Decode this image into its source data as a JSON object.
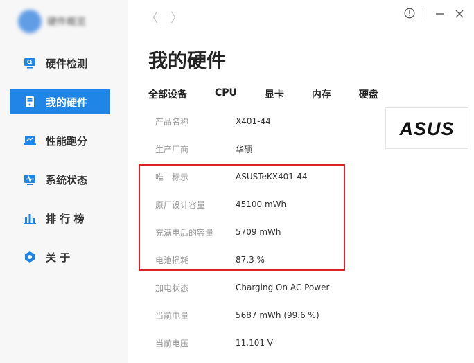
{
  "sidebar": {
    "app_name": "硬件概览",
    "items": [
      {
        "label": "硬件检测",
        "icon": "monitor-search-icon",
        "active": false
      },
      {
        "label": "我的硬件",
        "icon": "pc-tower-icon",
        "active": true
      },
      {
        "label": "性能跑分",
        "icon": "laptop-score-icon",
        "active": false
      },
      {
        "label": "系统状态",
        "icon": "pulse-icon",
        "active": false
      },
      {
        "label": "排 行 榜",
        "icon": "bar-chart-icon",
        "active": false
      },
      {
        "label": "关 于",
        "icon": "info-hexagon-icon",
        "active": false
      }
    ]
  },
  "header": {
    "back": "〈",
    "forward": "〉"
  },
  "main": {
    "title": "我的硬件",
    "tabs": [
      "全部设备",
      "CPU",
      "显卡",
      "内存",
      "硬盘"
    ],
    "brand": "ASUS",
    "rows": [
      {
        "label": "产品名称",
        "value": "X401-44"
      },
      {
        "label": "生产厂商",
        "value": "华硕"
      },
      {
        "label": "唯一标示",
        "value": "ASUSTeKX401-44"
      },
      {
        "label": "原厂设计容量",
        "value": "45100 mWh"
      },
      {
        "label": "充满电后的容量",
        "value": "5709 mWh"
      },
      {
        "label": "电池损耗",
        "value": "87.3 %"
      },
      {
        "label": "加电状态",
        "value": "Charging On AC Power"
      },
      {
        "label": "当前电量",
        "value": "5687 mWh (99.6 %)"
      },
      {
        "label": "当前电压",
        "value": "11.101 V"
      }
    ]
  },
  "colors": {
    "accent": "#1f86e8",
    "highlight": "#d9222a"
  }
}
